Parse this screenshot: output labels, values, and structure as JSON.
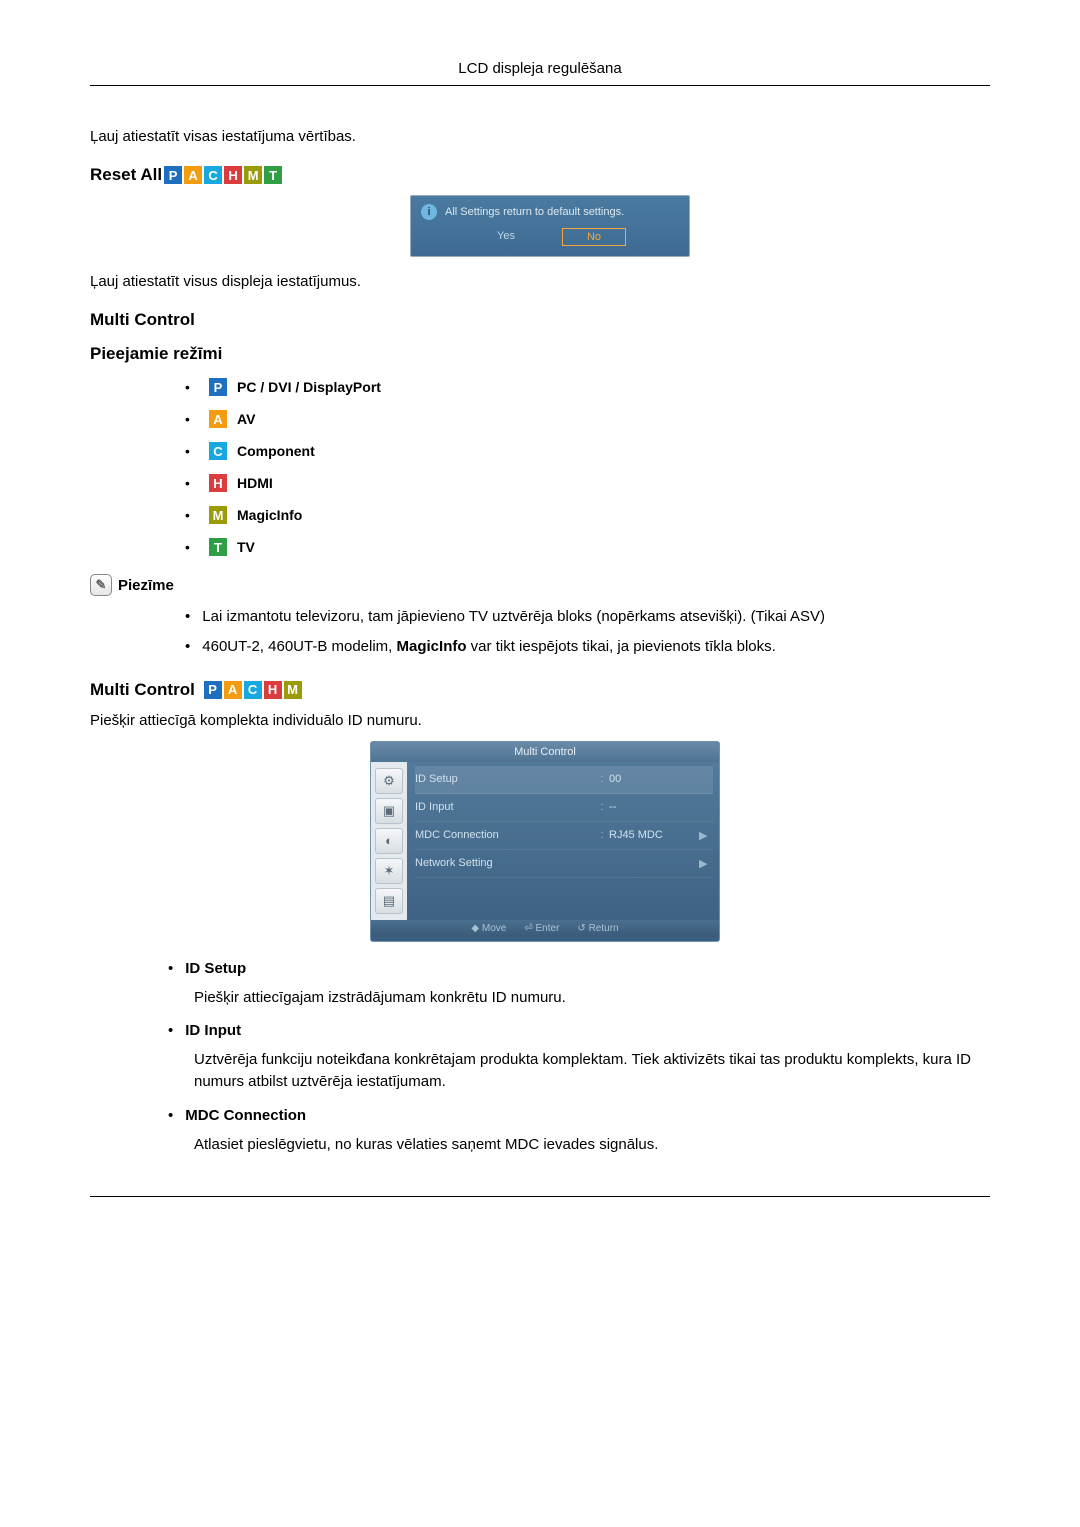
{
  "page_header": "LCD displeja regulēšana",
  "para_reset_color": "Ļauj atiestatīt visas iestatījuma vērtības.",
  "reset_all_heading": "Reset All",
  "reset_all_badges": [
    "P",
    "A",
    "C",
    "H",
    "M",
    "T"
  ],
  "dialog": {
    "message": "All Settings return to default settings.",
    "yes": "Yes",
    "no": "No"
  },
  "para_reset_all": "Ļauj atiestatīt visus displeja iestatījumus.",
  "multi_control_heading": "Multi Control",
  "available_modes_heading": "Pieejamie režīmi",
  "modes": [
    {
      "badge": "P",
      "label": "PC / DVI / DisplayPort"
    },
    {
      "badge": "A",
      "label": "AV"
    },
    {
      "badge": "C",
      "label": "Component"
    },
    {
      "badge": "H",
      "label": "HDMI"
    },
    {
      "badge": "M",
      "label": "MagicInfo"
    },
    {
      "badge": "T",
      "label": "TV"
    }
  ],
  "note_label": "Piezīme",
  "notes": [
    "Lai izmantotu televizoru, tam jāpievieno TV uztvērēja bloks (nopērkams atsevišķi). (Tikai ASV)",
    "__NOTE2__"
  ],
  "note2_prefix": "460UT-2, 460UT-B modelim, ",
  "note2_bold": "MagicInfo",
  "note2_suffix": " var tikt iespējots tikai, ja pievienots tīkla bloks.",
  "multi_control2_heading": "Multi Control",
  "multi_control2_badges": [
    "P",
    "A",
    "C",
    "H",
    "M"
  ],
  "multi_control2_desc": "Piešķir attiecīgā komplekta individuālo ID numuru.",
  "osd": {
    "title": "Multi Control",
    "rows": [
      {
        "label": "ID Setup",
        "val": "00",
        "arrow": false
      },
      {
        "label": "ID Input",
        "val": "--",
        "arrow": false
      },
      {
        "label": "MDC Connection",
        "val": "RJ45 MDC",
        "arrow": true
      },
      {
        "label": "Network Setting",
        "val": "",
        "arrow": true
      }
    ],
    "footer": {
      "move": "Move",
      "enter": "Enter",
      "return": "Return"
    }
  },
  "items": [
    {
      "title": "ID Setup",
      "body": "Piešķir attiecīgajam izstrādājumam konkrētu ID numuru."
    },
    {
      "title": "ID Input",
      "body": "Uztvērēja funkciju noteikđana konkrētajam produkta komplektam. Tiek aktivizēts tikai tas produktu komplekts, kura ID numurs atbilst uztvērēja iestatījumam."
    },
    {
      "title": "MDC Connection",
      "body": "Atlasiet pieslēgvietu, no kuras vēlaties saņemt MDC ievades signālus."
    }
  ]
}
